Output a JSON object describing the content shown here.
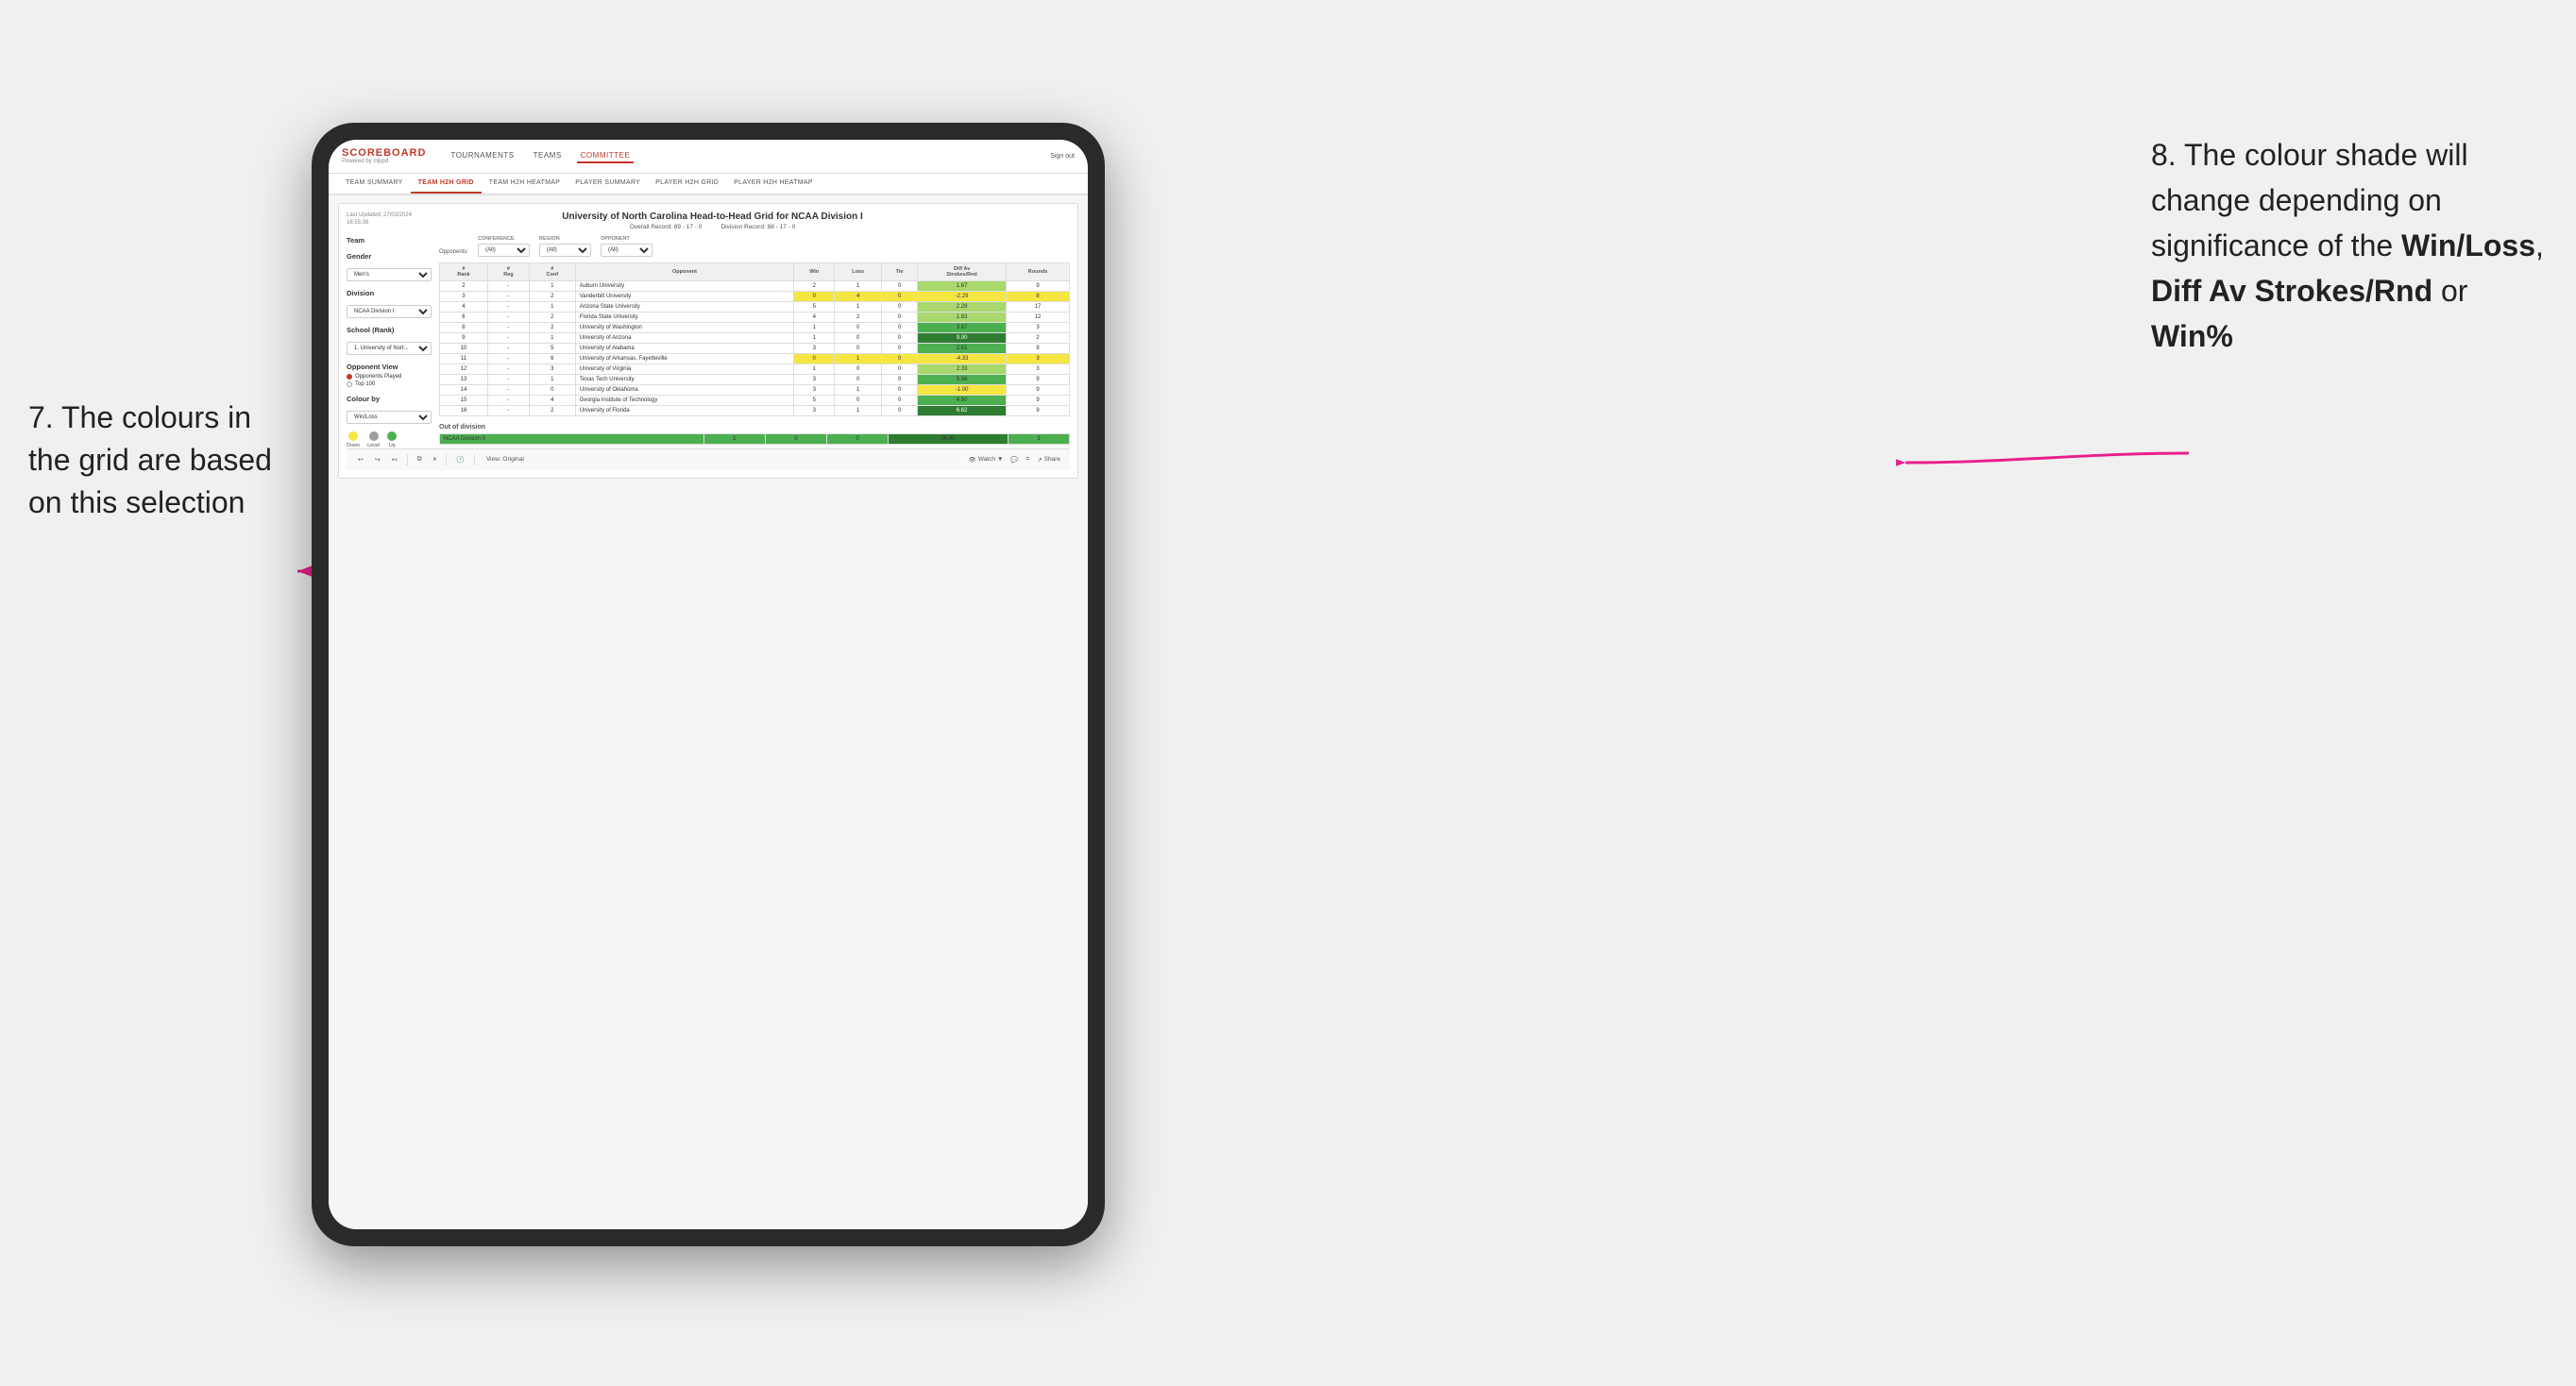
{
  "annotations": {
    "left": "7. The colours in the grid are based on this selection",
    "right_line1": "8. The colour shade will change depending on significance of the ",
    "right_bold1": "Win/Loss",
    "right_comma": ", ",
    "right_bold2": "Diff Av Strokes/Rnd",
    "right_or": " or ",
    "right_bold3": "Win%"
  },
  "nav": {
    "logo": "SCOREBOARD",
    "logo_sub": "Powered by clippd",
    "links": [
      "TOURNAMENTS",
      "TEAMS",
      "COMMITTEE"
    ],
    "sign_out": "Sign out"
  },
  "sub_tabs": [
    "TEAM SUMMARY",
    "TEAM H2H GRID",
    "TEAM H2H HEATMAP",
    "PLAYER SUMMARY",
    "PLAYER H2H GRID",
    "PLAYER H2H HEATMAP"
  ],
  "tableau": {
    "last_updated_label": "Last Updated: 27/03/2024",
    "last_updated_time": "16:55:38",
    "title": "University of North Carolina Head-to-Head Grid for NCAA Division I",
    "overall_record_label": "Overall Record:",
    "overall_record": "89 - 17 - 0",
    "division_record_label": "Division Record:",
    "division_record": "88 - 17 - 0"
  },
  "left_panel": {
    "team_label": "Team",
    "gender_label": "Gender",
    "gender_value": "Men's",
    "division_label": "Division",
    "division_value": "NCAA Division I",
    "school_label": "School (Rank)",
    "school_value": "1. University of Nort...",
    "opponent_view_label": "Opponent View",
    "radio_options": [
      "Opponents Played",
      "Top 100"
    ],
    "selected_radio": 0,
    "colour_by_label": "Colour by",
    "colour_by_value": "Win/Loss",
    "legend": [
      {
        "label": "Down",
        "color": "#f5e642"
      },
      {
        "label": "Level",
        "color": "#9e9e9e"
      },
      {
        "label": "Up",
        "color": "#4caf50"
      }
    ]
  },
  "filters": {
    "opponents_label": "Opponents:",
    "conference_label": "Conference",
    "conference_value": "(All)",
    "region_label": "Region",
    "region_value": "(All)",
    "opponent_label": "Opponent",
    "opponent_value": "(All)"
  },
  "table": {
    "headers": [
      "#\nRank",
      "#\nReg",
      "#\nConf",
      "Opponent",
      "Win",
      "Loss",
      "Tie",
      "Diff Av\nStrokes/Rnd",
      "Rounds"
    ],
    "rows": [
      {
        "rank": "2",
        "reg": "-",
        "conf": "1",
        "opponent": "Auburn University",
        "win": "2",
        "loss": "1",
        "tie": "0",
        "diff": "1.67",
        "rounds": "9",
        "win_color": "cell-white",
        "loss_color": "cell-white",
        "diff_color": "cell-green-light"
      },
      {
        "rank": "3",
        "reg": "-",
        "conf": "2",
        "opponent": "Vanderbilt University",
        "win": "0",
        "loss": "4",
        "tie": "0",
        "diff": "-2.29",
        "rounds": "8",
        "win_color": "cell-yellow",
        "loss_color": "cell-yellow",
        "diff_color": "cell-yellow"
      },
      {
        "rank": "4",
        "reg": "-",
        "conf": "1",
        "opponent": "Arizona State University",
        "win": "5",
        "loss": "1",
        "tie": "0",
        "diff": "2.28",
        "rounds": "17",
        "win_color": "cell-white",
        "loss_color": "cell-white",
        "diff_color": "cell-green-light"
      },
      {
        "rank": "6",
        "reg": "-",
        "conf": "2",
        "opponent": "Florida State University",
        "win": "4",
        "loss": "2",
        "tie": "0",
        "diff": "1.83",
        "rounds": "12",
        "win_color": "cell-white",
        "loss_color": "cell-white",
        "diff_color": "cell-green-light"
      },
      {
        "rank": "8",
        "reg": "-",
        "conf": "2",
        "opponent": "University of Washington",
        "win": "1",
        "loss": "0",
        "tie": "0",
        "diff": "3.67",
        "rounds": "3",
        "win_color": "cell-white",
        "loss_color": "cell-white",
        "diff_color": "cell-green"
      },
      {
        "rank": "9",
        "reg": "-",
        "conf": "1",
        "opponent": "University of Arizona",
        "win": "1",
        "loss": "0",
        "tie": "0",
        "diff": "9.00",
        "rounds": "2",
        "win_color": "cell-white",
        "loss_color": "cell-white",
        "diff_color": "cell-green-dark"
      },
      {
        "rank": "10",
        "reg": "-",
        "conf": "5",
        "opponent": "University of Alabama",
        "win": "3",
        "loss": "0",
        "tie": "0",
        "diff": "2.61",
        "rounds": "8",
        "win_color": "cell-white",
        "loss_color": "cell-white",
        "diff_color": "cell-green"
      },
      {
        "rank": "11",
        "reg": "-",
        "conf": "6",
        "opponent": "University of Arkansas, Fayetteville",
        "win": "0",
        "loss": "1",
        "tie": "0",
        "diff": "-4.33",
        "rounds": "3",
        "win_color": "cell-yellow",
        "loss_color": "cell-yellow",
        "diff_color": "cell-yellow"
      },
      {
        "rank": "12",
        "reg": "-",
        "conf": "3",
        "opponent": "University of Virginia",
        "win": "1",
        "loss": "0",
        "tie": "0",
        "diff": "2.33",
        "rounds": "3",
        "win_color": "cell-white",
        "loss_color": "cell-white",
        "diff_color": "cell-green-light"
      },
      {
        "rank": "13",
        "reg": "-",
        "conf": "1",
        "opponent": "Texas Tech University",
        "win": "3",
        "loss": "0",
        "tie": "0",
        "diff": "5.56",
        "rounds": "9",
        "win_color": "cell-white",
        "loss_color": "cell-white",
        "diff_color": "cell-green"
      },
      {
        "rank": "14",
        "reg": "-",
        "conf": "0",
        "opponent": "University of Oklahoma",
        "win": "3",
        "loss": "1",
        "tie": "0",
        "diff": "-1.00",
        "rounds": "9",
        "win_color": "cell-white",
        "loss_color": "cell-white",
        "diff_color": "cell-yellow"
      },
      {
        "rank": "15",
        "reg": "-",
        "conf": "4",
        "opponent": "Georgia Institute of Technology",
        "win": "5",
        "loss": "0",
        "tie": "0",
        "diff": "4.50",
        "rounds": "9",
        "win_color": "cell-white",
        "loss_color": "cell-white",
        "diff_color": "cell-green"
      },
      {
        "rank": "16",
        "reg": "-",
        "conf": "2",
        "opponent": "University of Florida",
        "win": "3",
        "loss": "1",
        "tie": "0",
        "diff": "6.62",
        "rounds": "9",
        "win_color": "cell-white",
        "loss_color": "cell-white",
        "diff_color": "cell-green-dark"
      }
    ],
    "out_of_division_label": "Out of division",
    "out_of_division_rows": [
      {
        "division": "NCAA Division II",
        "win": "1",
        "loss": "0",
        "tie": "0",
        "diff": "26.00",
        "rounds": "3",
        "diff_color": "cell-green-dark"
      }
    ]
  },
  "toolbar": {
    "view_label": "View: Original",
    "watch_label": "Watch",
    "share_label": "Share"
  }
}
